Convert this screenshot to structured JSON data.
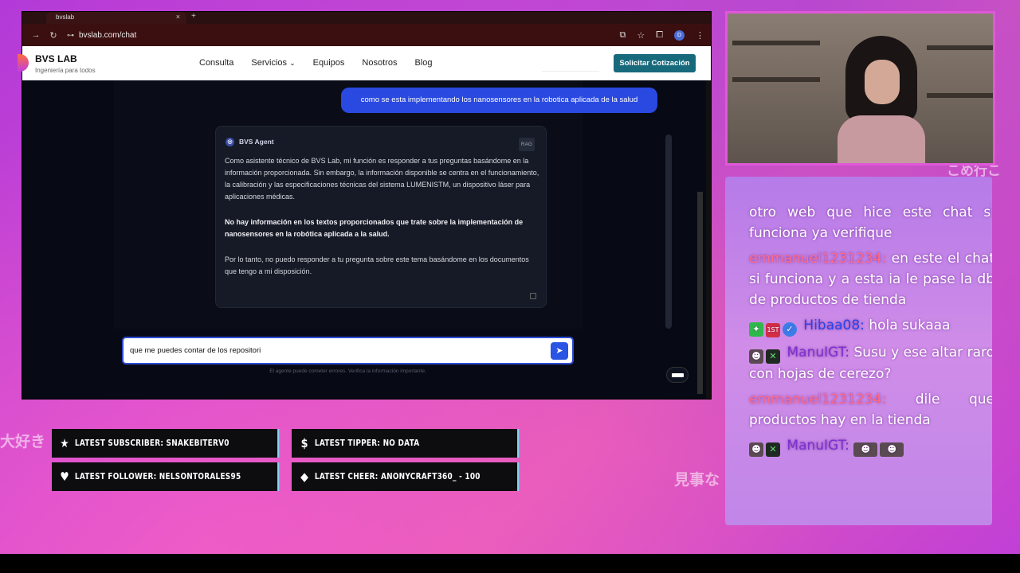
{
  "browser": {
    "tab_title": "bvslab",
    "tab_new": "+",
    "url": "bvslab.com/chat",
    "profile_initial": "D"
  },
  "site": {
    "brand_title": "BVS LAB",
    "brand_sub": "Ingeniería para todos",
    "nav": [
      "Consulta",
      "Servicios",
      "Equipos",
      "Nosotros",
      "Blog"
    ],
    "services_chevron": "⌄",
    "cta": "Solicitar Cotización"
  },
  "chat": {
    "user_message": "como se esta implementando los nanosensores en la robotica aplicada de la salud",
    "agent_name": "BVS Agent",
    "agent_tag": "RAG",
    "agent_p1": "Como asistente técnico de BVS Lab, mi función es responder a tus preguntas basándome en la información proporcionada. Sin embargo, la información disponible se centra en el funcionamiento, la calibración y las especificaciones técnicas del sistema LUMENISTM, un dispositivo láser para aplicaciones médicas.",
    "agent_p2": "No hay información en los textos proporcionados que trate sobre la implementación de nanosensores en la robótica aplicada a la salud.",
    "agent_p3": "Por lo tanto, no puedo responder a tu pregunta sobre este tema basándome en los documentos que tengo a mi disposición.",
    "input_value": "que me puedes contar de los repositori",
    "disclaimer": "El agente puede cometer errores. Verifica la información importante."
  },
  "stream_chat": {
    "messages": [
      {
        "user": "",
        "text": "otro web que hice este chat si funciona ya verifique"
      },
      {
        "user": "emmanuel1231234:",
        "text": "en este el chat si funciona y a esta ia le pase la db de productos de tienda"
      },
      {
        "user": "Hibaa08:",
        "text": "hola sukaaa"
      },
      {
        "user": "ManuIGT:",
        "text": "Susu y ese altar raro con hojas de cerezo?"
      },
      {
        "user": "emmanuel1231234:",
        "text": "dile que productos hay en la tienda"
      },
      {
        "user": "ManuIGT:",
        "text": ""
      }
    ],
    "badge_first": "1ST"
  },
  "widgets": {
    "latest_subscriber": "LATEST SUBSCRIBER: SNAKEBITERV0",
    "latest_tipper": "LATEST TIPPER: NO DATA",
    "latest_follower": "LATEST FOLLOWER: NELSONTORALES95",
    "latest_cheer": "LATEST CHEER: ANONYCRAFT360_ - 100"
  },
  "overlay_text": {
    "left": "大好き",
    "right_top": "こめ行こ",
    "right_mid": "見事な"
  },
  "colors": {
    "cta": "#17697c",
    "user_bubble": "#2a49e0",
    "send_button": "#2a54e4",
    "username_emmanuel": "#ff6a88",
    "username_hibaa": "#2a45e8",
    "username_manu": "#7a30d0"
  }
}
